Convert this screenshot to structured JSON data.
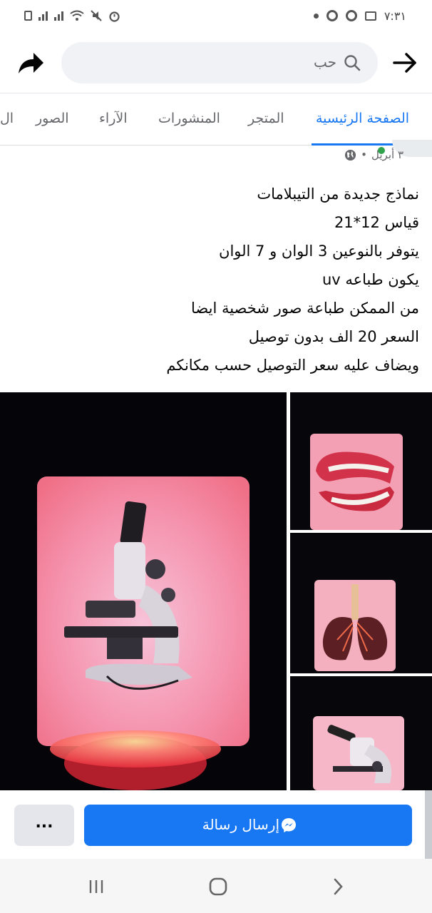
{
  "status_bar": {
    "time": "٧:٣١"
  },
  "header": {
    "search_text": "حب",
    "icons": [
      "back-arrow-icon",
      "search-icon",
      "share-icon"
    ]
  },
  "tabs": [
    {
      "label": "الصفحة الرئيسية",
      "active": true
    },
    {
      "label": "المتجر",
      "active": false
    },
    {
      "label": "المنشورات",
      "active": false
    },
    {
      "label": "الآراء",
      "active": false
    },
    {
      "label": "الصور",
      "active": false
    },
    {
      "label": "ال",
      "active": false
    }
  ],
  "post": {
    "date": "٣ أبريل",
    "separator": "•",
    "privacy_icon": "globe-icon",
    "lines": [
      "نماذج جديدة من التيبلامات",
      "قياس  12*21",
      "يتوفر بالنوعين 3 الوان و 7 الوان",
      "يكون طباعه uv",
      "من الممكن طباعة صور شخصية ايضا",
      "السعر 20 الف بدون توصيل",
      "ويضاف عليه سعر التوصيل حسب مكانكم"
    ]
  },
  "actions": {
    "message_label": "إرسال رسالة",
    "more_label": "..."
  },
  "colors": {
    "accent": "#1877f2",
    "text": "#050505",
    "secondary": "#65676b",
    "lamp_pink": "#f37a8e"
  }
}
